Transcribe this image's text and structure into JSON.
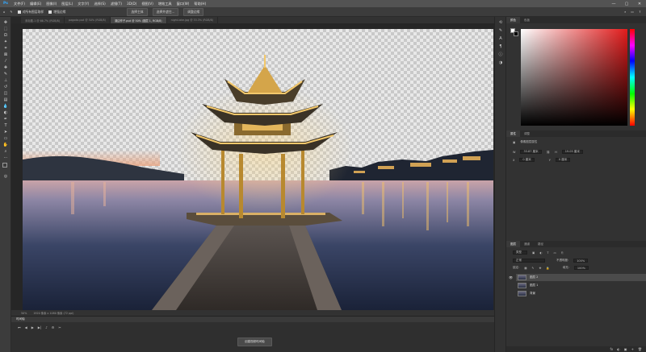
{
  "menu": {
    "logo": "Ps",
    "items": [
      "文件(F)",
      "编辑(E)",
      "图像(I)",
      "图层(L)",
      "文字(Y)",
      "选择(S)",
      "滤镜(T)",
      "3D(D)",
      "视图(V)",
      "增效工具",
      "窗口(W)",
      "帮助(H)"
    ],
    "win_controls": [
      "—",
      "▢",
      "✕"
    ]
  },
  "options": {
    "items": [
      "选择主体",
      "选择并遮住...",
      "调整边缘"
    ],
    "labels": [
      "对所有图层取样",
      "增强边缘"
    ]
  },
  "tabs": [
    {
      "label": "未标题-1 @ 66.7% (RGB/8)",
      "active": false
    },
    {
      "label": "pagoda.psd @ 50% (RGB/8)",
      "active": false
    },
    {
      "label": "湖边亭子.psd @ 50% (图层 1, RGB/8)",
      "active": true
    },
    {
      "label": "night-lake.jpg @ 33.3% (RGB/8)",
      "active": false
    }
  ],
  "status": {
    "zoom": "50%",
    "info": "1920 像素 x 1080 像素 (72 ppi)"
  },
  "timeline": {
    "title": "时间轴",
    "create_label": "创建视频时间轴"
  },
  "color_panel": {
    "tabs": [
      "颜色",
      "色板"
    ],
    "fg_color": "#ffffff",
    "bg_color": "#000000",
    "hue_color": "#e21b1b"
  },
  "properties_panel": {
    "tabs": [
      "属性",
      "调整"
    ],
    "title": "像素图层属性",
    "w_label": "W",
    "w_value": "33.87 厘米",
    "h_label": "H",
    "h_value": "19.05 厘米",
    "x_label": "X",
    "x_value": "0 厘米",
    "y_label": "Y",
    "y_value": "0 厘米"
  },
  "layers_panel": {
    "tabs": [
      "图层",
      "通道",
      "路径"
    ],
    "kind": "类型",
    "mode": "正常",
    "opacity_label": "不透明度:",
    "opacity": "100%",
    "lock_label": "锁定:",
    "fill_label": "填充:",
    "fill": "100%",
    "layers": [
      {
        "name": "图层 2",
        "selected": true,
        "visible": true
      },
      {
        "name": "图层 1",
        "selected": false,
        "visible": false
      },
      {
        "name": "背景",
        "selected": false,
        "visible": false
      }
    ],
    "footer_icons": [
      "fx",
      "◐",
      "▣",
      "+",
      "🗑"
    ]
  }
}
